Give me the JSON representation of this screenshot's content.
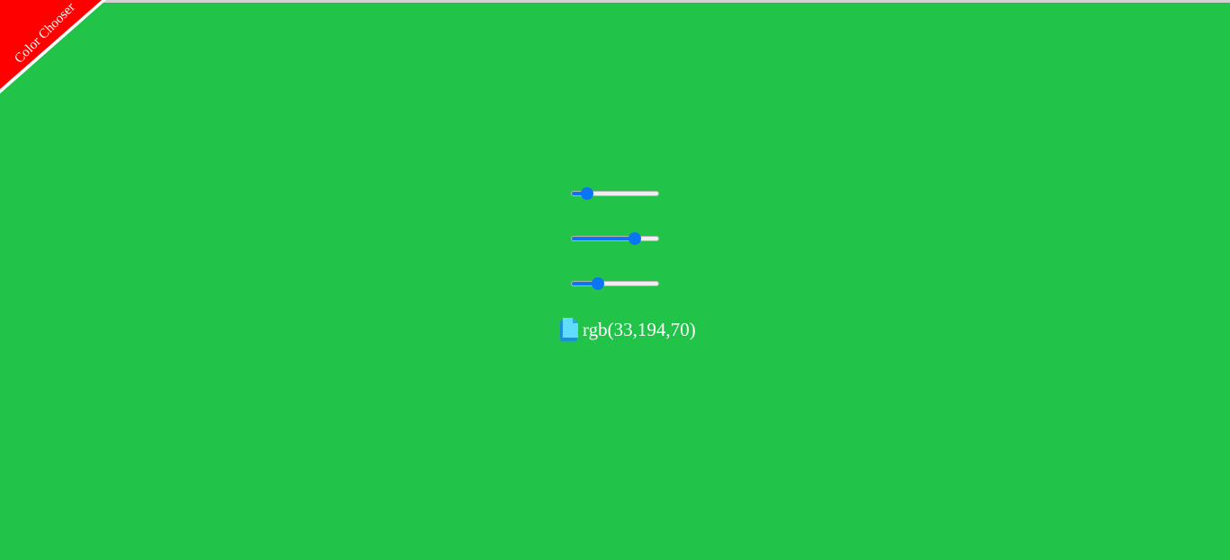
{
  "page": {
    "background_color": "#21c449"
  },
  "ribbon": {
    "label": "Color Chooser",
    "color": "#ff0000",
    "text_color": "#ffffff"
  },
  "sliders": [
    {
      "name": "red",
      "value": 33,
      "max": 255
    },
    {
      "name": "green",
      "value": 194,
      "max": 255
    },
    {
      "name": "blue",
      "value": 70,
      "max": 255
    }
  ],
  "slider_accent": "#0b75f4",
  "readout": {
    "icon": "copy-icon",
    "text": "rgb(33,194,70)"
  }
}
